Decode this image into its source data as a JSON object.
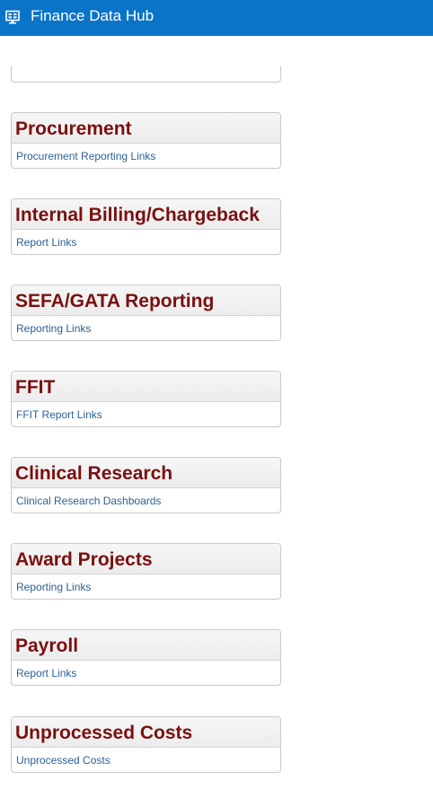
{
  "header": {
    "title": "Finance Data Hub",
    "icon": "dashboard-monitor-icon",
    "background_color": "#0a74c8"
  },
  "colors": {
    "card_title": "#7a1010",
    "link": "#2b5f96"
  },
  "cards": [
    {
      "title": "Procurement",
      "link": "Procurement Reporting Links"
    },
    {
      "title": "Internal Billing/Chargeback",
      "link": "Report Links"
    },
    {
      "title": "SEFA/GATA Reporting",
      "link": "Reporting Links"
    },
    {
      "title": "FFIT",
      "link": "FFIT Report Links"
    },
    {
      "title": "Clinical Research",
      "link": "Clinical Research Dashboards"
    },
    {
      "title": "Award Projects",
      "link": "Reporting Links"
    },
    {
      "title": "Payroll",
      "link": "Report Links"
    },
    {
      "title": "Unprocessed Costs",
      "link": "Unprocessed Costs"
    }
  ]
}
